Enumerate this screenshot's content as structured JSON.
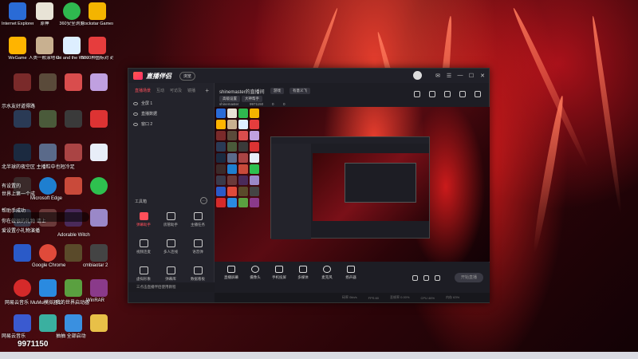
{
  "desktop": {
    "icons": [
      {
        "label": "Internet Explorer",
        "color": "#2a6bd6"
      },
      {
        "label": "原神",
        "color": "#e8e3d6"
      },
      {
        "label": "360安全浏览",
        "color": "#2fb84f"
      },
      {
        "label": "Rockstar Games...",
        "color": "#f4b400"
      },
      {
        "label": "WeGame",
        "color": "#ffb400"
      },
      {
        "label": "人类一败涂地 Human Fa...",
        "color": "#c8b090"
      },
      {
        "label": "Ori and the Will of the...",
        "color": "#ddeeff"
      },
      {
        "label": "5000种图标对 封1.76（推荐...",
        "color": "#e63d3d"
      }
    ],
    "overlay_texts": [
      "示水友好道得路",
      "北半球的夜空区 主播粒中也短冷足",
      "有设置的",
      "世界上第一个成",
      "帮助手成功",
      "你在做很的礼物 请上",
      "爱设置小礼物演播",
      "9971150",
      "网易云音乐",
      "MuMu模拟器12",
      "我的世界启动器",
      "WinRAR",
      "Microsoft Edge",
      "Adorable Witch",
      "Google Chrome",
      "cmbiaotar 2",
      "网易云音乐",
      "抽抽 全部启动"
    ],
    "taskbar_number": "9971150"
  },
  "window": {
    "app_name": "直播伴侣",
    "beta_label": "浏览",
    "left": {
      "tabs": [
        "直播场景",
        "互动",
        "可访及",
        "镜播"
      ],
      "layers": [
        "全屏 1",
        "直播数据",
        "窗口 2"
      ],
      "tools_title": "工具箱",
      "tools": [
        {
          "label": "弹幕助手",
          "active": true
        },
        {
          "label": "房管助手"
        },
        {
          "label": "主播任务"
        },
        {
          "label": "视频连麦"
        },
        {
          "label": "多人连线"
        },
        {
          "label": "语音弹"
        },
        {
          "label": "虚拟形象"
        },
        {
          "label": "弹幕库"
        },
        {
          "label": "数据看板"
        }
      ],
      "notice": "三点击直播伴侣使用教程"
    },
    "header": {
      "stream_title": "shinemaster的直播间",
      "chip_1": "游戏",
      "chip_2": "有意义飞",
      "tag_1": "高级设置",
      "tag_2": "大神帮手",
      "info_user": "shinemaster",
      "info_id": "9971150",
      "info_likes": "0",
      "info_views": "0"
    },
    "controls": [
      {
        "label": "直播屏幕"
      },
      {
        "label": "摄像头"
      },
      {
        "label": "手机投屏"
      },
      {
        "label": "多媒体"
      },
      {
        "label": "麦克风"
      },
      {
        "label": "扬声器"
      }
    ],
    "start_button": "开始直播",
    "status": [
      "码率 0kb/s",
      "FPS:60",
      "丢帧率 0.00%",
      "CPU 46%",
      "内存 63%"
    ]
  }
}
